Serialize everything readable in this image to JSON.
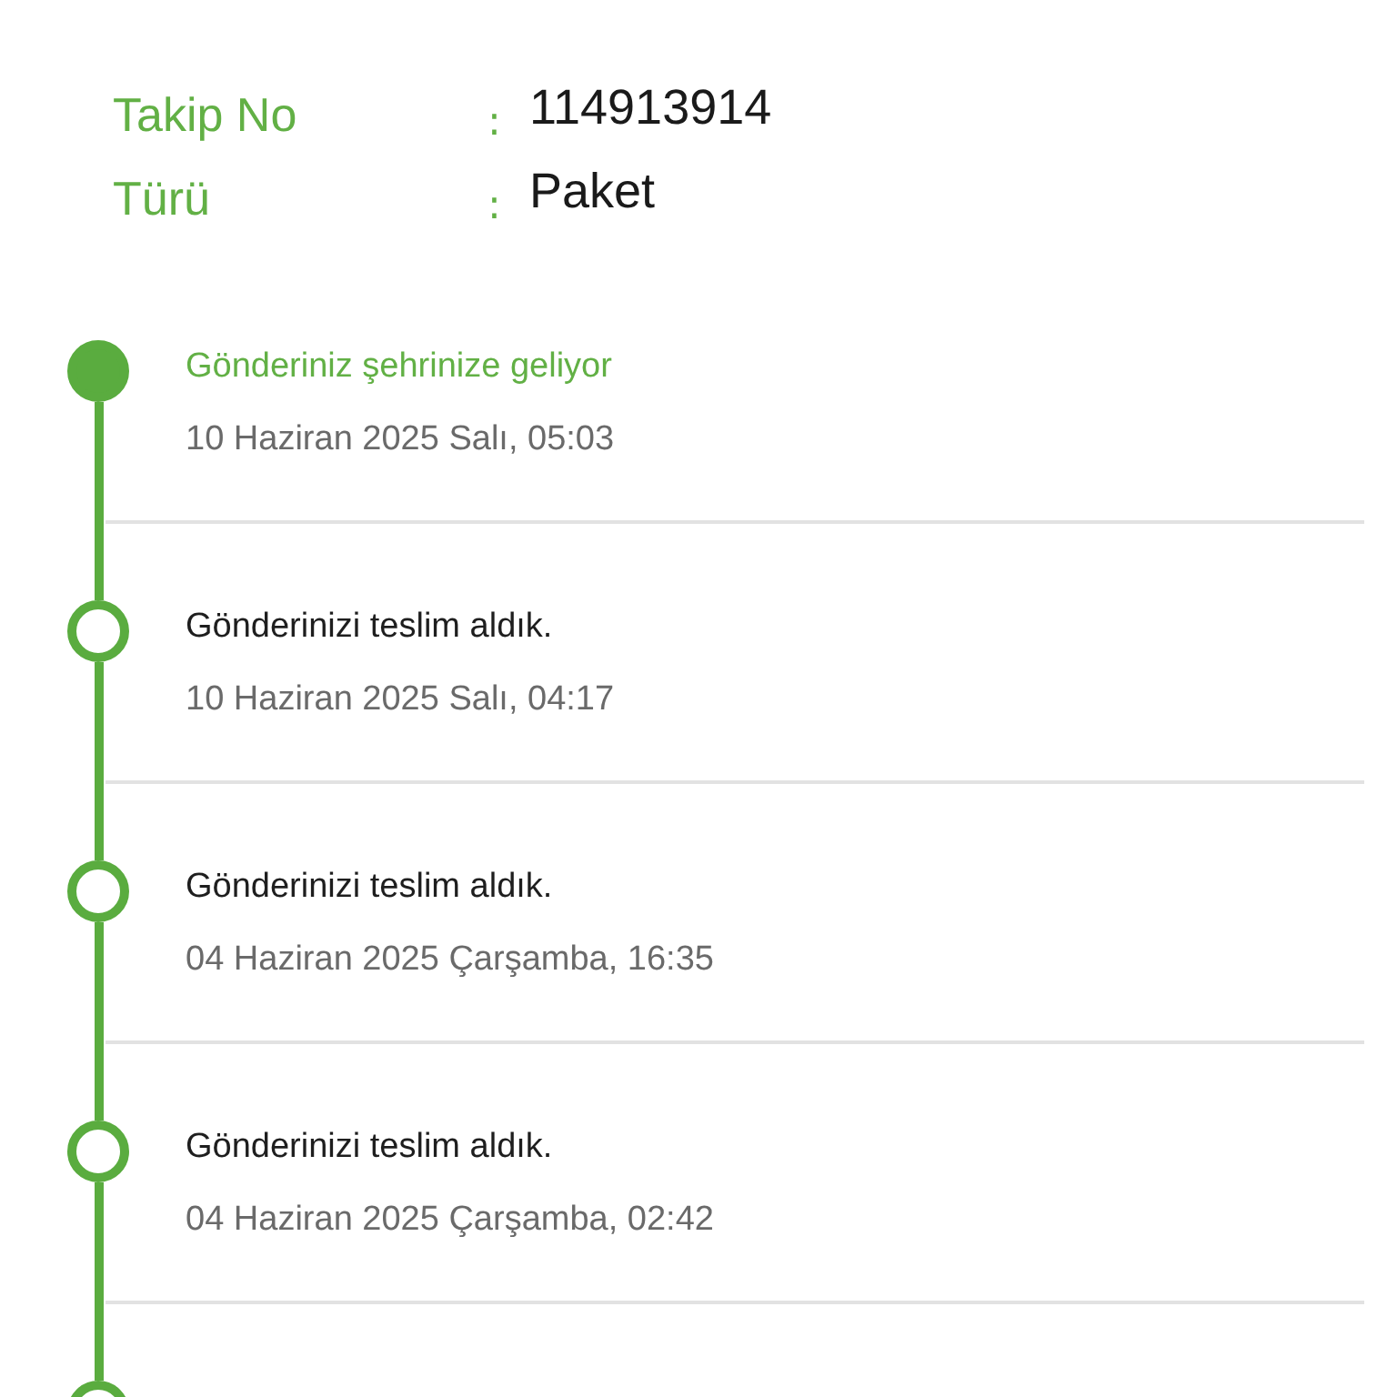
{
  "details": [
    {
      "label": "Takip No",
      "separator": ":",
      "value": "114913914"
    },
    {
      "label": "Türü",
      "separator": ":",
      "value": "Paket"
    }
  ],
  "events": [
    {
      "title": "Gönderiniz şehrinize geliyor",
      "date": "10 Haziran 2025 Salı, 05:03",
      "current": true
    },
    {
      "title": "Gönderinizi teslim aldık.",
      "date": "10 Haziran 2025 Salı, 04:17",
      "current": false
    },
    {
      "title": "Gönderinizi teslim aldık.",
      "date": "04 Haziran 2025 Çarşamba, 16:35",
      "current": false
    },
    {
      "title": "Gönderinizi teslim aldık.",
      "date": "04 Haziran 2025 Çarşamba, 02:42",
      "current": false
    }
  ],
  "more_below": true
}
